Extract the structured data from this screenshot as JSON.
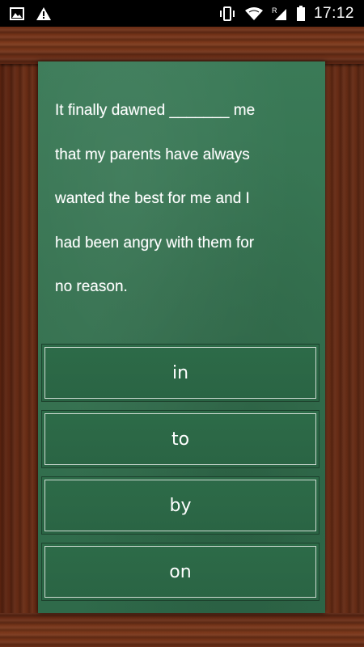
{
  "status_bar": {
    "time": "17:12",
    "icons": [
      "image-icon",
      "warning-icon",
      "vibrate-icon",
      "wifi-icon",
      "roaming-r-icon",
      "signal-icon",
      "battery-icon"
    ]
  },
  "question": {
    "lines": [
      "It finally dawned _______  me",
      "that my parents have always",
      "wanted the best for me and I",
      "had been angry with them for",
      "no reason."
    ]
  },
  "answers": [
    "in",
    "to",
    "by",
    "on"
  ],
  "colors": {
    "board": "#357250",
    "answer_bg": "#2d6b48",
    "wood": "#7a3519",
    "text": "#ffffff"
  }
}
